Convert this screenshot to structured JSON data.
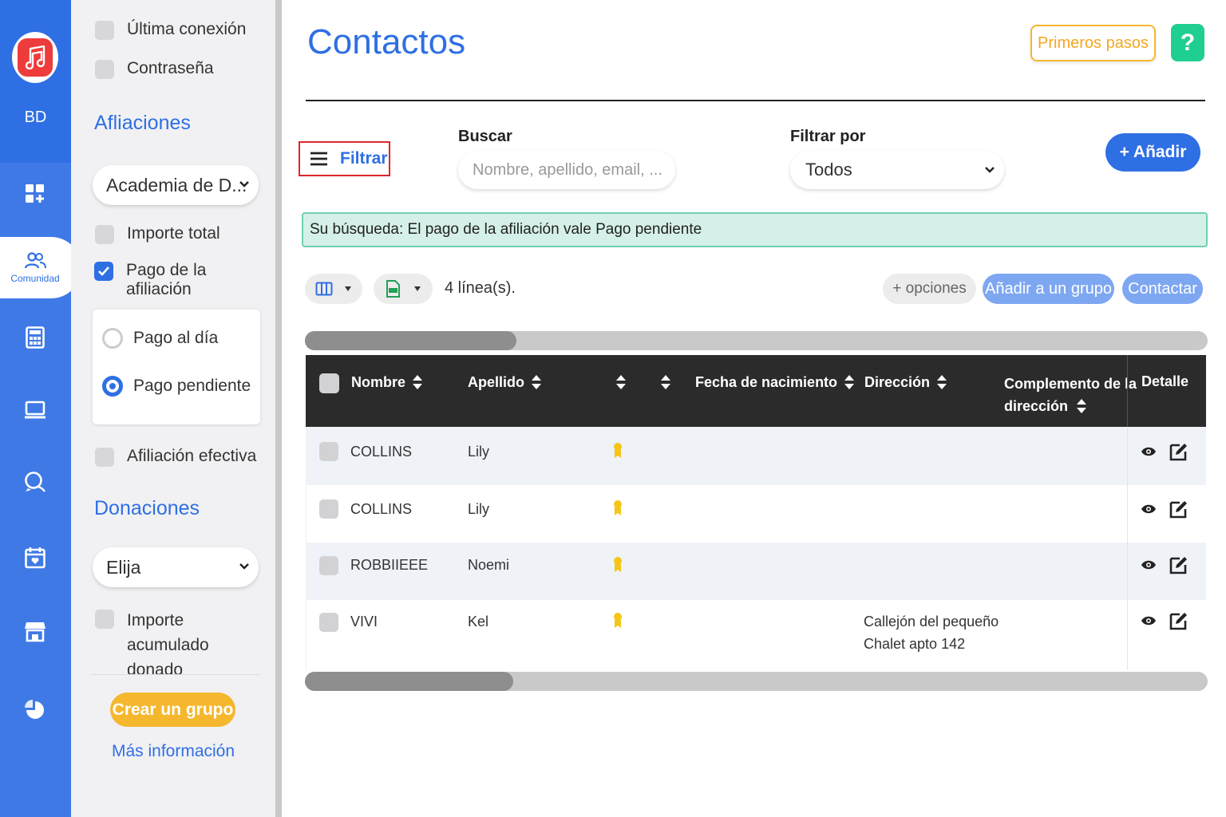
{
  "nav": {
    "brand": "BD",
    "active_label": "Comunidad"
  },
  "panel": {
    "cb_ultima": "Última conexión",
    "cb_contrasena": "Contraseña",
    "afliaciones_title": "Afliaciones",
    "academia_select": "Academia de D...",
    "cb_importe_total": "Importe total",
    "cb_pago_afiliacion": "Pago de la afiliación",
    "radio_al_dia": "Pago al día",
    "radio_pendiente": "Pago pendiente",
    "cb_afiliacion_efectiva": "Afiliación efectiva",
    "donaciones_title": "Donaciones",
    "donaciones_select": "Elija",
    "cb_importe_acumulado": "Importe acumulado donado",
    "crear_grupo": "Crear un grupo",
    "mas_info": "Más información"
  },
  "header": {
    "title": "Contactos",
    "first_steps": "Primeros pasos",
    "help": "?"
  },
  "toolbar": {
    "filtrar": "Filtrar",
    "buscar_label": "Buscar",
    "buscar_placeholder": "Nombre, apellido, email, ...",
    "filtrar_por_label": "Filtrar por",
    "filtrar_por_value": "Todos",
    "anadir": "+ Añadir"
  },
  "search_info": "Su búsqueda: El pago de la afiliación vale Pago pendiente",
  "actions": {
    "lines": "4 línea(s).",
    "opciones": "+ opciones",
    "anadir_grupo": "Añadir a un grupo",
    "contactar": "Contactar"
  },
  "table": {
    "headers": {
      "nombre": "Nombre",
      "apellido": "Apellido",
      "fecha": "Fecha de nacimiento",
      "direccion": "Dirección",
      "complemento_1": "Complemento de la",
      "complemento_2": "dirección",
      "detalle": "Detalle"
    },
    "rows": [
      {
        "nombre": "COLLINS",
        "apellido": "Lily",
        "direccion_1": "",
        "direccion_2": ""
      },
      {
        "nombre": "COLLINS",
        "apellido": "Lily",
        "direccion_1": "",
        "direccion_2": ""
      },
      {
        "nombre": "ROBBIIEEE",
        "apellido": "Noemi",
        "direccion_1": "",
        "direccion_2": ""
      },
      {
        "nombre": "VIVI",
        "apellido": "Kel",
        "direccion_1": "Callejón del pequeño",
        "direccion_2": "Chalet apto 142"
      }
    ]
  },
  "colors": {
    "primary": "#2f6fe4",
    "accent_yellow": "#f5b72e",
    "help_green": "#1fcf8f",
    "info_bg": "#d5f0e8",
    "table_head": "#2b2b2b"
  }
}
